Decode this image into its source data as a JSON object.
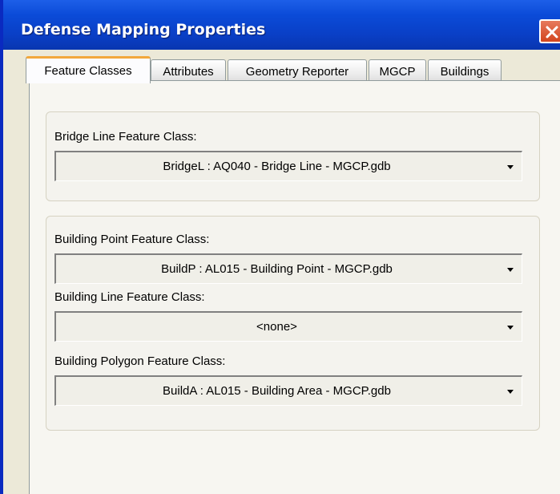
{
  "window": {
    "title": "Defense Mapping Properties"
  },
  "tabs": [
    {
      "label": "Feature Classes",
      "active": true
    },
    {
      "label": "Attributes",
      "active": false
    },
    {
      "label": "Geometry Reporter",
      "active": false
    },
    {
      "label": "MGCP",
      "active": false
    },
    {
      "label": "Buildings",
      "active": false
    }
  ],
  "bridge_group": {
    "label": "Bridge Line Feature Class:",
    "value": "BridgeL : AQ040 - Bridge Line - MGCP.gdb"
  },
  "building_group": {
    "point_label": "Building Point Feature Class:",
    "point_value": "BuildP : AL015 - Building Point - MGCP.gdb",
    "line_label": "Building Line Feature Class:",
    "line_value": "<none>",
    "polygon_label": "Building Polygon Feature Class:",
    "polygon_value": "BuildA : AL015 - Building Area - MGCP.gdb"
  },
  "icons": {
    "close": "close-icon",
    "dropdown": "chevron-down-icon"
  },
  "colors": {
    "titlebar": "#0b4bd8",
    "close_button": "#d2451e",
    "active_tab_accent": "#f2a83b",
    "dialog_background": "#ece9d8"
  }
}
